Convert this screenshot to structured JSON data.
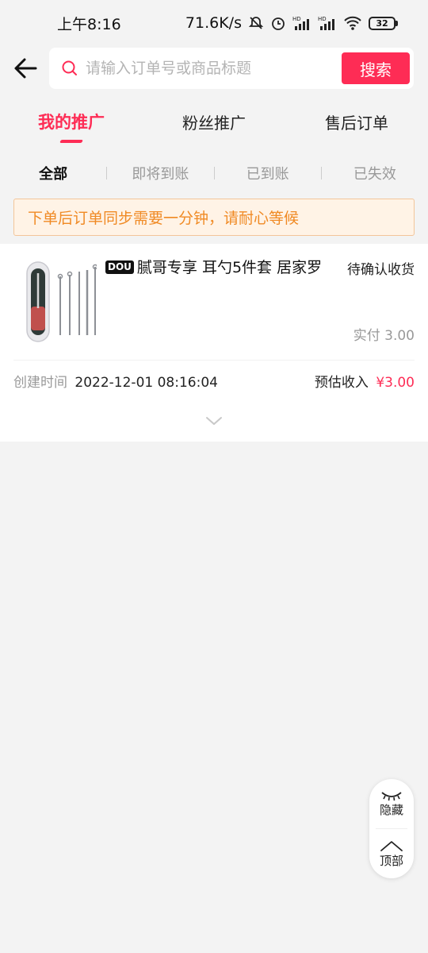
{
  "status_bar": {
    "time": "上午8:16",
    "network_speed": "71.6K/s",
    "battery": "32"
  },
  "search": {
    "placeholder": "请输入订单号或商品标题",
    "button_label": "搜索"
  },
  "main_tabs": [
    {
      "label": "我的推广",
      "active": true
    },
    {
      "label": "粉丝推广",
      "active": false
    },
    {
      "label": "售后订单",
      "active": false
    }
  ],
  "sub_tabs": [
    {
      "label": "全部",
      "active": true
    },
    {
      "label": "即将到账",
      "active": false
    },
    {
      "label": "已到账",
      "active": false
    },
    {
      "label": "已失效",
      "active": false
    }
  ],
  "notice": "下单后订单同步需要一分钟，请耐心等候",
  "order": {
    "badge": "DOU",
    "title": "腻哥专享    耳勺5件套 居家罗",
    "status": "待确认收货",
    "paid": "实付 3.00",
    "created_label": "创建时间",
    "created_value": "2022-12-01 08:16:04",
    "income_label": "预估收入",
    "income_value": "¥3.00"
  },
  "float_panel": {
    "hide_label": "隐藏",
    "top_label": "顶部"
  },
  "colors": {
    "accent": "#fe2c55",
    "notice_text": "#f08a24",
    "notice_bg": "#fff3e6"
  }
}
